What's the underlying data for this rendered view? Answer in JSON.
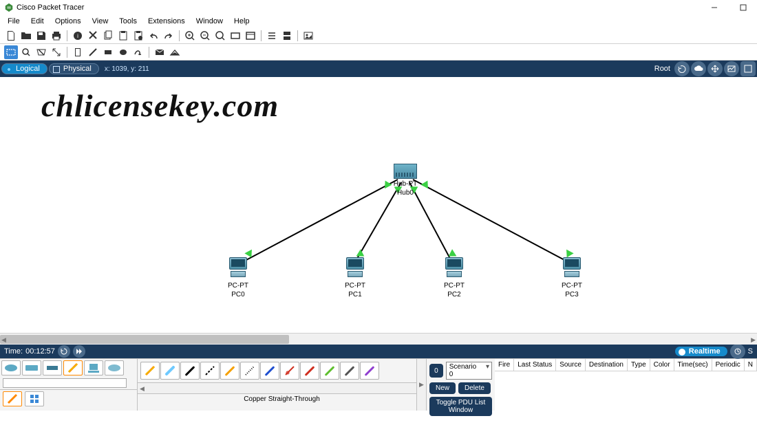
{
  "app": {
    "title": "Cisco Packet Tracer"
  },
  "menu": {
    "file": "File",
    "edit": "Edit",
    "options": "Options",
    "view": "View",
    "tools": "Tools",
    "extensions": "Extensions",
    "window": "Window",
    "help": "Help"
  },
  "nav": {
    "logical": "Logical",
    "physical": "Physical",
    "coords": "x: 1039, y: 211",
    "root": "Root"
  },
  "watermark": "chlicensekey.com",
  "devices": {
    "hub": {
      "type": "Hub-PT",
      "name": "Hub0"
    },
    "pc0": {
      "type": "PC-PT",
      "name": "PC0"
    },
    "pc1": {
      "type": "PC-PT",
      "name": "PC1"
    },
    "pc2": {
      "type": "PC-PT",
      "name": "PC2"
    },
    "pc3": {
      "type": "PC-PT",
      "name": "PC3"
    }
  },
  "time": {
    "label": "Time:",
    "value": "00:12:57",
    "realtime": "Realtime"
  },
  "connections": {
    "selected_label": "Copper Straight-Through"
  },
  "scenario": {
    "icon": "0",
    "selected": "Scenario 0",
    "new_btn": "New",
    "delete_btn": "Delete",
    "toggle_btn": "Toggle PDU List Window"
  },
  "pdu_cols": {
    "fire": "Fire",
    "last": "Last Status",
    "source": "Source",
    "dest": "Destination",
    "type": "Type",
    "color": "Color",
    "timesec": "Time(sec)",
    "periodic": "Periodic",
    "n": "N"
  }
}
